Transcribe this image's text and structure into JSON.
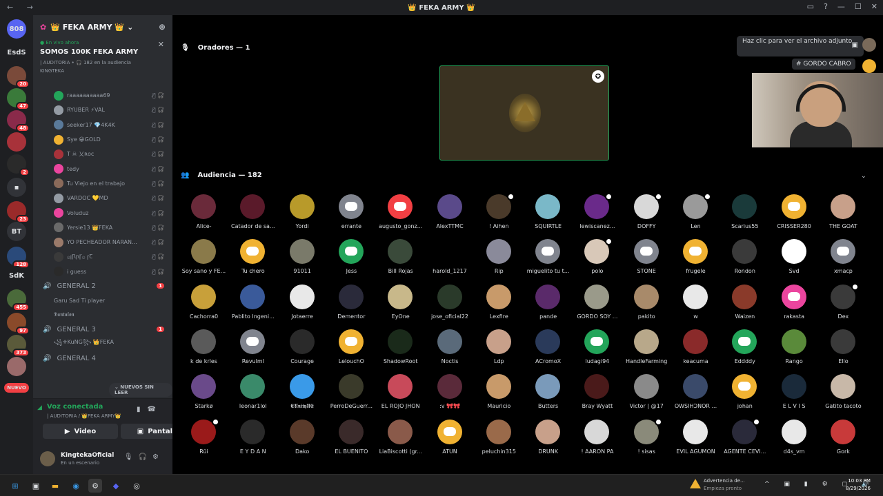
{
  "window": {
    "title": "👑 FEKA ARMY 👑",
    "back": "←",
    "forward": "→"
  },
  "guilds": [
    {
      "label": "808",
      "color": "#5865f2",
      "badge": ""
    },
    {
      "label": "EsdS",
      "color": "#1e1f22",
      "badge": ""
    },
    {
      "label": "",
      "color": "#7a4a3a",
      "badge": "20"
    },
    {
      "label": "",
      "color": "#3a7a3a",
      "badge": "47"
    },
    {
      "label": "",
      "color": "#8a2a4a",
      "badge": "48"
    },
    {
      "label": "",
      "color": "#a8323a",
      "badge": ""
    },
    {
      "label": "",
      "color": "#2a2a2a",
      "badge": "2"
    },
    {
      "label": "▪",
      "color": "#313338",
      "badge": ""
    },
    {
      "label": "",
      "color": "#9a2a2a",
      "badge": "23"
    },
    {
      "label": "BT",
      "color": "#313338",
      "badge": ""
    },
    {
      "label": "",
      "color": "#2a4a7a",
      "badge": "128"
    },
    {
      "label": "SdK",
      "color": "#1e1f22",
      "badge": ""
    },
    {
      "label": "",
      "color": "#4a6a3a",
      "badge": "455"
    },
    {
      "label": "",
      "color": "#8a4a2a",
      "badge": "97"
    },
    {
      "label": "",
      "color": "#5a5a3a",
      "badge": "373"
    },
    {
      "label": "",
      "color": "#9a6a6a",
      "badge": ""
    },
    {
      "label": "NUEVO",
      "color": "#f23f43",
      "badge": ""
    }
  ],
  "server": {
    "name": "👑 FEKA ARMY 👑"
  },
  "live": {
    "tag": "● En vivo ahora",
    "title": "SOMOS 100K FEKA ARMY",
    "sub": "| AUDITORIA • 🎧 182 en la audiencia",
    "host": "KINGTEKA"
  },
  "members": [
    {
      "name": "raaaaaaaaaa69",
      "color": "#23a55a"
    },
    {
      "name": "RYUBER ⚡VAL",
      "color": "#949ba4"
    },
    {
      "name": "seeker17 💎4K4K",
      "color": "#5a7a9a"
    },
    {
      "name": "Sye 😀GOLD",
      "color": "#f0b232"
    },
    {
      "name": "T ☠ 乂ʀᴏᴄ",
      "color": "#a8323a"
    },
    {
      "name": "tedy",
      "color": "#eb459e"
    },
    {
      "name": "Tu Viejo en el trabajo",
      "color": "#8a6a5a"
    },
    {
      "name": "VARDOC 💛MD",
      "color": "#949ba4"
    },
    {
      "name": "Voluduz",
      "color": "#eb459e"
    },
    {
      "name": "Yersie13 👑FEKA",
      "color": "#6a6a6a"
    },
    {
      "name": "YO PECHEADOR NARAN...",
      "color": "#9a7a6a"
    },
    {
      "name": "۞ꞁꞂꞃꞄ۞ ꞅꞆ",
      "color": "#3a3a3a"
    },
    {
      "name": "i guess",
      "color": "#2a2a2a"
    }
  ],
  "channels": [
    {
      "name": "GENERAL 2",
      "count": "1",
      "subs": [
        "Garu Sad Ti player",
        "𝕯𝖆𝖓𝖙𝖆𝖑𝖔𝖓"
      ]
    },
    {
      "name": "GENERAL 3",
      "count": "1",
      "subs": [
        "꧁⚜KuNG꧂ 👑FEKA"
      ]
    },
    {
      "name": "GENERAL 4",
      "count": "",
      "subs": []
    }
  ],
  "unread_pill": "⌄ NUEVOS SIN LEER",
  "voice": {
    "status": "Voz conectada",
    "channel": "| AUDITORIA / 👑FEKA ARMY👑",
    "video": "Video",
    "screen": "Pantalla"
  },
  "user": {
    "name": "KingtekaOficial",
    "status": "En un escenario"
  },
  "stage": {
    "speakers_label": "Oradores — 1",
    "audience_label": "Audiencia — 182"
  },
  "tooltip": "Haz clic para ver el archivo adjunto",
  "channel_tag": "# GORDO CABRO",
  "audience": [
    {
      "name": "Alice-",
      "c": "#6a2a3a",
      "dc": false,
      "mod": false
    },
    {
      "name": "Catador de sa...",
      "c": "#5a1a2a",
      "dc": false,
      "mod": false
    },
    {
      "name": "Yordi",
      "c": "#b89a2a",
      "dc": false,
      "mod": false
    },
    {
      "name": "errante",
      "c": "#80848e",
      "dc": true,
      "mod": false
    },
    {
      "name": "augusto_gonz...",
      "c": "#f23f43",
      "dc": true,
      "mod": false
    },
    {
      "name": "AlexTTMC",
      "c": "#5a4a8a",
      "dc": false,
      "mod": false
    },
    {
      "name": "! Aihen",
      "c": "#4a3a2a",
      "dc": false,
      "mod": true
    },
    {
      "name": "SQUIRTLE",
      "c": "#7ab8c8",
      "dc": false,
      "mod": false
    },
    {
      "name": "lewiscanez...",
      "c": "#6a2a8a",
      "dc": false,
      "mod": true
    },
    {
      "name": "DOFFY",
      "c": "#d8d8d8",
      "dc": false,
      "mod": true
    },
    {
      "name": "Len",
      "c": "#9a9a9a",
      "dc": false,
      "mod": true
    },
    {
      "name": "Scarius55",
      "c": "#1a3a3a",
      "dc": false,
      "mod": false
    },
    {
      "name": "CRISSER280",
      "c": "#f0b232",
      "dc": true,
      "mod": false
    },
    {
      "name": "THE GOAT",
      "c": "#c8a08a",
      "dc": false,
      "mod": false
    },
    {
      "name": "Soy sano y FE...",
      "c": "#8a7a4a",
      "dc": false,
      "mod": false
    },
    {
      "name": "Tu chero",
      "c": "#f0b232",
      "dc": true,
      "mod": false
    },
    {
      "name": "91011",
      "c": "#7a7a6a",
      "dc": false,
      "mod": false
    },
    {
      "name": "Jess",
      "c": "#23a55a",
      "dc": true,
      "mod": false
    },
    {
      "name": "Bill Rojas",
      "c": "#3a4a3a",
      "dc": false,
      "mod": false
    },
    {
      "name": "harold_1217",
      "c": "#000000",
      "dc": false,
      "mod": false
    },
    {
      "name": "Rip",
      "c": "#8a8a9a",
      "dc": false,
      "mod": false
    },
    {
      "name": "miguelito tu t...",
      "c": "#80848e",
      "dc": true,
      "mod": false
    },
    {
      "name": "polo",
      "c": "#d8c8b8",
      "dc": false,
      "mod": true
    },
    {
      "name": "STONE",
      "c": "#80848e",
      "dc": true,
      "mod": false
    },
    {
      "name": "frugele",
      "c": "#f0b232",
      "dc": true,
      "mod": false
    },
    {
      "name": "Rondon",
      "c": "#3a3a3a",
      "dc": false,
      "mod": false
    },
    {
      "name": "Svd",
      "c": "#ffffff",
      "dc": false,
      "mod": false
    },
    {
      "name": "xmacp",
      "c": "#80848e",
      "dc": true,
      "mod": false
    },
    {
      "name": "Cachorra0",
      "c": "#c8a03a",
      "dc": false,
      "mod": false
    },
    {
      "name": "Pablito Ingeni...",
      "c": "#3a5a9a",
      "dc": false,
      "mod": false
    },
    {
      "name": "Jotaerre",
      "c": "#e8e8e8",
      "dc": false,
      "mod": false
    },
    {
      "name": "Dementor",
      "c": "#2a2a3a",
      "dc": false,
      "mod": false
    },
    {
      "name": "EyOne",
      "c": "#c8b88a",
      "dc": false,
      "mod": false
    },
    {
      "name": "jose_oficial22",
      "c": "#2a3a2a",
      "dc": false,
      "mod": false
    },
    {
      "name": "Lexfire",
      "c": "#c89a6a",
      "dc": false,
      "mod": false
    },
    {
      "name": "pande",
      "c": "#5a2a6a",
      "dc": false,
      "mod": false
    },
    {
      "name": "GORDO SOY ...",
      "c": "#9a9a8a",
      "dc": false,
      "mod": false
    },
    {
      "name": "pakito",
      "c": "#a88a6a",
      "dc": false,
      "mod": false
    },
    {
      "name": "w",
      "c": "#e8e8e8",
      "dc": false,
      "mod": false
    },
    {
      "name": "Waizen",
      "c": "#8a3a2a",
      "dc": false,
      "mod": false
    },
    {
      "name": "rakasta",
      "c": "#eb459e",
      "dc": true,
      "mod": false
    },
    {
      "name": "Dex",
      "c": "#3a3a3a",
      "dc": false,
      "mod": true
    },
    {
      "name": "k de krles",
      "c": "#5a5a5a",
      "dc": false,
      "mod": false
    },
    {
      "name": "Revulml",
      "c": "#80848e",
      "dc": true,
      "mod": false
    },
    {
      "name": "Courage",
      "c": "#2a2a2a",
      "dc": false,
      "mod": false
    },
    {
      "name": "LelouchO",
      "c": "#f0b232",
      "dc": true,
      "mod": false
    },
    {
      "name": "ShadowRoot",
      "c": "#1a2a1a",
      "dc": false,
      "mod": false
    },
    {
      "name": "Noctis",
      "c": "#5a6a7a",
      "dc": false,
      "mod": false
    },
    {
      "name": "Ldp",
      "c": "#c8a08a",
      "dc": false,
      "mod": false
    },
    {
      "name": "ACromoX",
      "c": "#2a3a5a",
      "dc": false,
      "mod": false
    },
    {
      "name": "ludagi94",
      "c": "#23a55a",
      "dc": true,
      "mod": false
    },
    {
      "name": "HandleFarming",
      "c": "#b8a88a",
      "dc": false,
      "mod": false
    },
    {
      "name": "keacuma",
      "c": "#8a2a2a",
      "dc": false,
      "mod": false
    },
    {
      "name": "Eddddy",
      "c": "#23a55a",
      "dc": true,
      "mod": false
    },
    {
      "name": "Rango",
      "c": "#5a8a3a",
      "dc": false,
      "mod": false
    },
    {
      "name": "Ello",
      "c": "#3a3a3a",
      "dc": false,
      "mod": false
    },
    {
      "name": "Starkø",
      "c": "#6a4a8a",
      "dc": false,
      "mod": false
    },
    {
      "name": "leonar1lol",
      "c": "#3a8a6a",
      "dc": false,
      "mod": false
    },
    {
      "name": "𝕰𝖀𝖓𝖎𝖙𝖞𝖀𝕰",
      "c": "#3a9ae8",
      "dc": false,
      "mod": false
    },
    {
      "name": "PerroDeGuerr...",
      "c": "#3a3a2a",
      "dc": false,
      "mod": false
    },
    {
      "name": "EL ROJO JHON",
      "c": "#c84a5a",
      "dc": false,
      "mod": false
    },
    {
      "name": ":v 🎀🎀",
      "c": "#5a2a3a",
      "dc": false,
      "mod": false
    },
    {
      "name": "Mauricio",
      "c": "#c89a6a",
      "dc": false,
      "mod": false
    },
    {
      "name": "Butters",
      "c": "#7a9aba",
      "dc": false,
      "mod": false
    },
    {
      "name": "Bray Wyatt",
      "c": "#4a1a1a",
      "dc": false,
      "mod": false
    },
    {
      "name": "Victor | @17",
      "c": "#8a8a8a",
      "dc": false,
      "mod": false
    },
    {
      "name": "OWSIHƆNOR ...",
      "c": "#3a4a6a",
      "dc": false,
      "mod": false
    },
    {
      "name": "johan",
      "c": "#f0b232",
      "dc": true,
      "mod": false
    },
    {
      "name": "E L V I S",
      "c": "#1a2a3a",
      "dc": false,
      "mod": false
    },
    {
      "name": "Gatito tacoto",
      "c": "#c8b8a8",
      "dc": false,
      "mod": false
    },
    {
      "name": "Rüi",
      "c": "#9a1a1a",
      "dc": false,
      "mod": true
    },
    {
      "name": "E Y D A N",
      "c": "#2a2a2a",
      "dc": false,
      "mod": false
    },
    {
      "name": "Dako",
      "c": "#5a3a2a",
      "dc": false,
      "mod": false
    },
    {
      "name": "EL BUENITO",
      "c": "#3a2a2a",
      "dc": false,
      "mod": false
    },
    {
      "name": "LiaBiscotti (gr...",
      "c": "#8a5a4a",
      "dc": false,
      "mod": false
    },
    {
      "name": "ATUN",
      "c": "#f0b232",
      "dc": true,
      "mod": false
    },
    {
      "name": "peluchin315",
      "c": "#9a6a4a",
      "dc": false,
      "mod": false
    },
    {
      "name": "DRUNK",
      "c": "#c8a08a",
      "dc": false,
      "mod": false
    },
    {
      "name": "! AARON PA",
      "c": "#d8d8d8",
      "dc": false,
      "mod": false
    },
    {
      "name": "! sisas",
      "c": "#8a8a7a",
      "dc": false,
      "mod": true
    },
    {
      "name": "EVIL AGUMON",
      "c": "#e8e8e8",
      "dc": false,
      "mod": false
    },
    {
      "name": "AGENTE CEVI...",
      "c": "#2a2a3a",
      "dc": false,
      "mod": true
    },
    {
      "name": "d4s_vm",
      "c": "#e8e8e8",
      "dc": false,
      "mod": false
    },
    {
      "name": "Gork",
      "c": "#c83a3a",
      "dc": false,
      "mod": false
    }
  ],
  "taskbar": {
    "notif_title": "Advertencia de...",
    "notif_sub": "Empieza pronto",
    "time": "10:03 PM",
    "date": "8/29/2026"
  }
}
